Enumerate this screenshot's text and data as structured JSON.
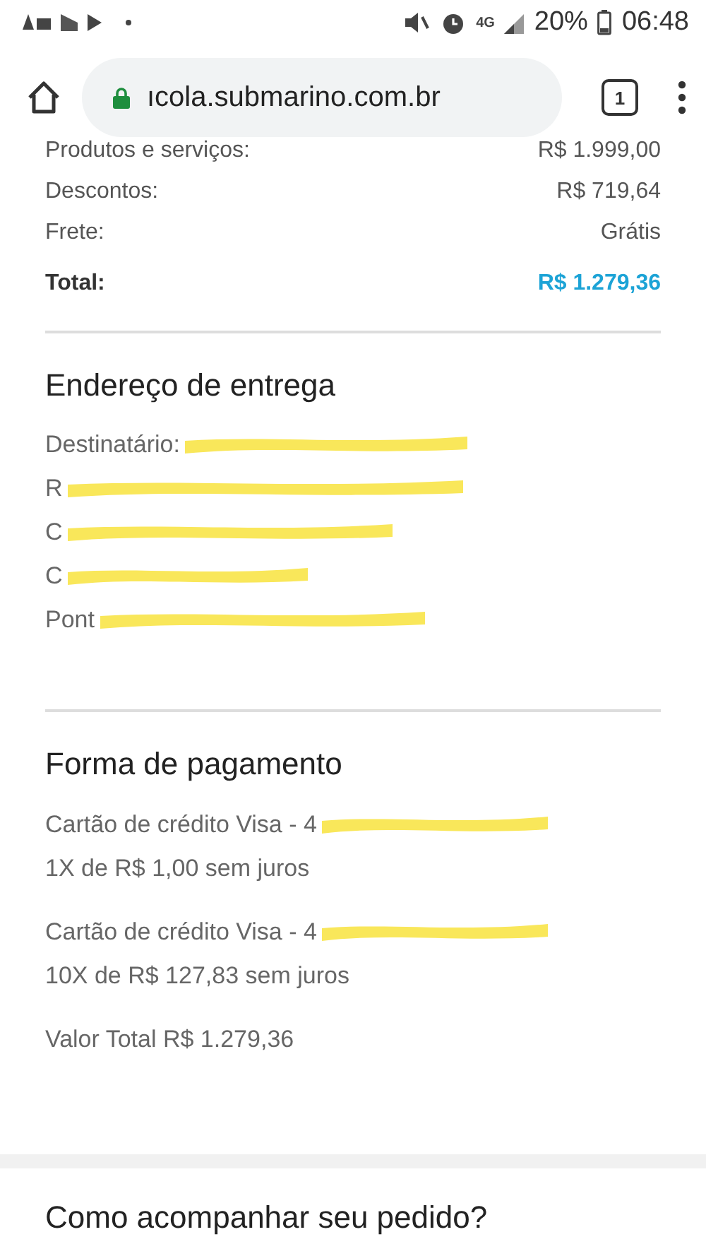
{
  "status_bar": {
    "battery": "20%",
    "time": "06:48",
    "network": "4G"
  },
  "browser": {
    "url": "ıcola.submarino.com.br",
    "tab_count": "1"
  },
  "summary": {
    "rows": [
      {
        "label": "Produtos e serviços:",
        "value": "R$ 1.999,00"
      },
      {
        "label": "Descontos:",
        "value": "R$ 719,64"
      },
      {
        "label": "Frete:",
        "value": "Grátis"
      }
    ],
    "total": {
      "label": "Total:",
      "value": "R$ 1.279,36"
    }
  },
  "address": {
    "title": "Endereço de entrega",
    "lines": [
      "Destinatário:",
      "R",
      "C",
      "C",
      "Pont"
    ]
  },
  "payment": {
    "title": "Forma de pagamento",
    "cards": [
      {
        "card": "Cartão de crédito Visa - 4",
        "installments": "1X de R$ 1,00 sem juros"
      },
      {
        "card": "Cartão de crédito Visa - 4",
        "installments": "10X de R$ 127,83 sem juros"
      }
    ],
    "total": "Valor Total R$ 1.279,36"
  },
  "next_section": {
    "title": "Como acompanhar seu pedido?"
  }
}
